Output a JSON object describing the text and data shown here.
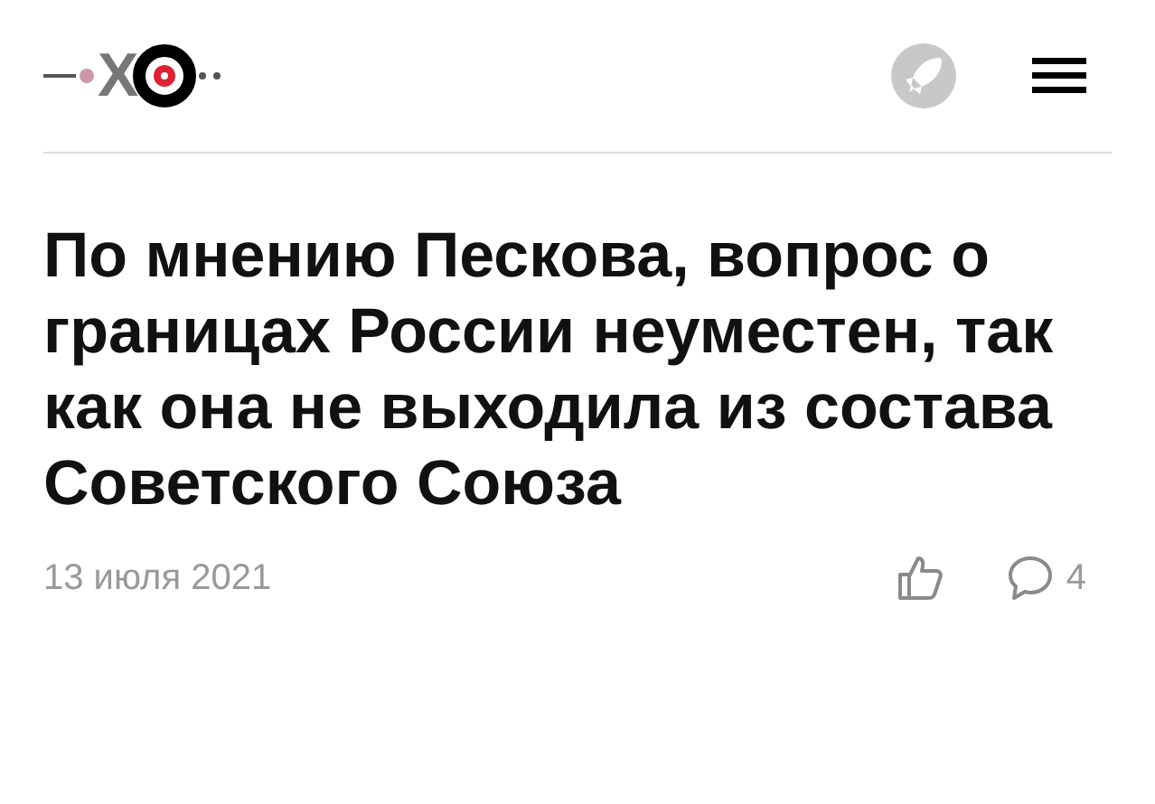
{
  "header": {
    "logo_letter": "Х"
  },
  "article": {
    "headline": "По мнению Пескова, вопрос о границах России неуместен, так как она не выходила из состава Советского Союза",
    "date": "13 июля 2021",
    "comments_count": "4"
  }
}
